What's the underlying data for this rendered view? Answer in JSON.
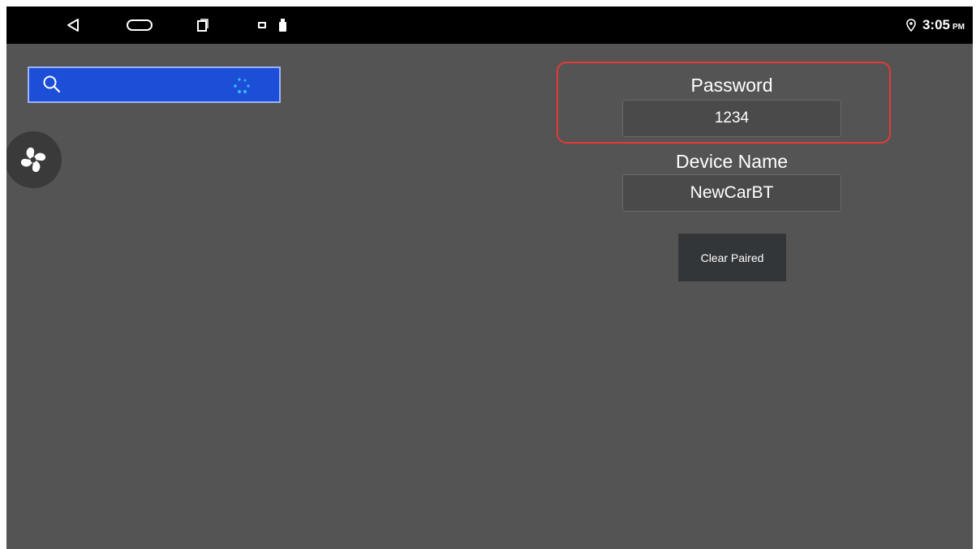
{
  "status_bar": {
    "nav_icons": [
      "back-icon",
      "home-icon",
      "recents-icon"
    ],
    "notification_icons": [
      "image-notification-icon",
      "usb-notification-icon"
    ],
    "location_icon": "location-pin-icon",
    "time": "3:05",
    "ampm": "PM"
  },
  "search": {
    "icon": "search-icon",
    "loading_icon": "loading-spinner-icon"
  },
  "fan_button": {
    "icon": "fan-icon"
  },
  "password": {
    "label": "Password",
    "value": "1234"
  },
  "device_name": {
    "label": "Device Name",
    "value": "NewCarBT"
  },
  "clear_paired_button": {
    "label": "Clear Paired"
  },
  "colors": {
    "background": "#545454",
    "status_bar": "#000000",
    "search_bar": "#1d4ed8",
    "highlight": "#e53935",
    "button": "#333639"
  }
}
